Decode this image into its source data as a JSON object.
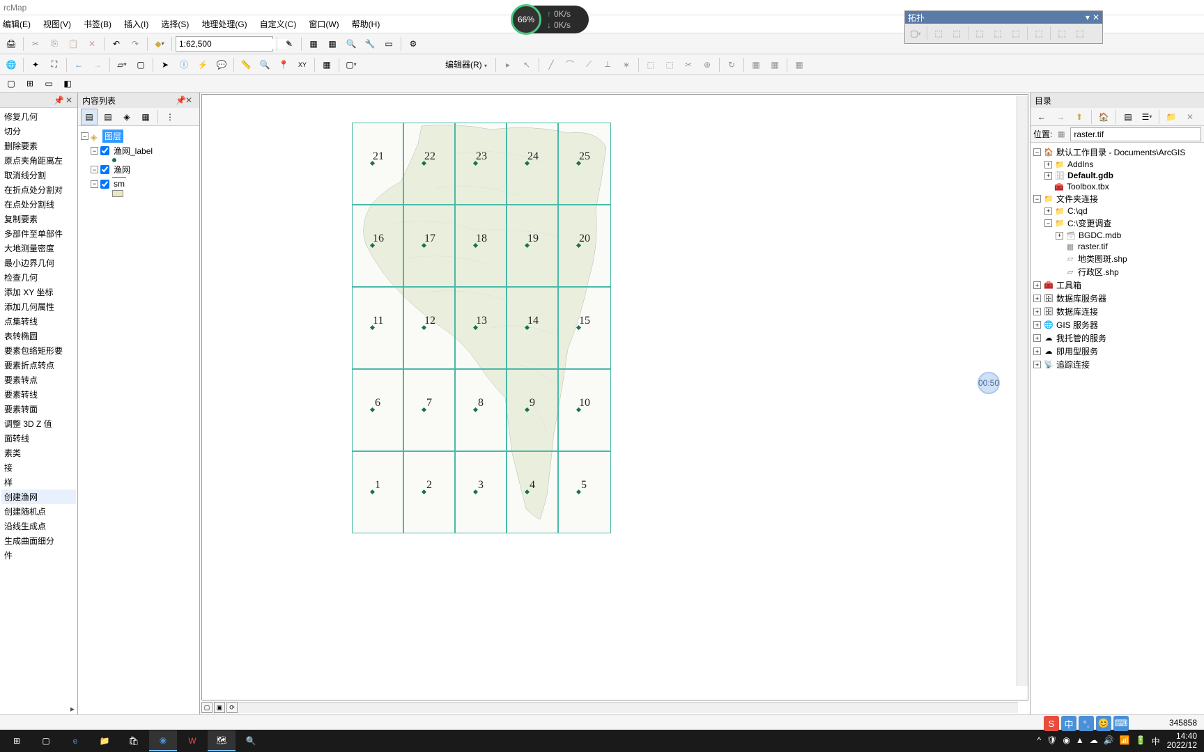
{
  "title": "rcMap",
  "menu": [
    "编辑(E)",
    "视图(V)",
    "书签(B)",
    "插入(I)",
    "选择(S)",
    "地理处理(G)",
    "自定义(C)",
    "窗口(W)",
    "帮助(H)"
  ],
  "scale": "1:62,500",
  "editor_label": "编辑器(R)",
  "topology": {
    "title": "拓扑"
  },
  "speed": {
    "pct": "66%",
    "up": "0K/s",
    "down": "0K/s"
  },
  "timer": "00:50",
  "toc": {
    "title": "内容列表",
    "root": "图层",
    "layers": [
      "渔网_label",
      "渔网",
      "sm"
    ]
  },
  "left_tools": [
    "修复几何",
    "切分",
    "删除要素",
    "原点夹角距离左",
    "取消线分割",
    "在折点处分割对",
    "在点处分割线",
    "复制要素",
    "多部件至单部件",
    "大地测量密度",
    "最小边界几何",
    "检查几何",
    "添加 XY 坐标",
    "添加几何属性",
    "点集转线",
    "表转椭圆",
    "要素包络矩形要",
    "要素折点转点",
    "要素转点",
    "要素转线",
    "要素转面",
    "调整 3D Z 值",
    "面转线",
    "素类",
    "接",
    "样",
    "创建渔网",
    "创建随机点",
    "沿线生成点",
    "生成曲面细分",
    "件"
  ],
  "left_highlight_index": 26,
  "grid_labels": {
    "row0": [
      "21",
      "22",
      "23",
      "24",
      "25"
    ],
    "row1": [
      "16",
      "17",
      "18",
      "19",
      "20"
    ],
    "row2": [
      "11",
      "12",
      "13",
      "14",
      "15"
    ],
    "row3": [
      "6",
      "7",
      "8",
      "9",
      "10"
    ],
    "row4": [
      "1",
      "2",
      "3",
      "4",
      "5"
    ]
  },
  "catalog": {
    "title": "目录",
    "location_label": "位置:",
    "location_value": "raster.tif",
    "tree": {
      "root1": "默认工作目录 - Documents\\ArcGIS",
      "addins": "AddIns",
      "defaultgdb": "Default.gdb",
      "toolboxtbx": "Toolbox.tbx",
      "folderconn": "文件夹连接",
      "cqd": "C:\\qd",
      "cbgdc": "C:\\变更调查",
      "bgdcmdb": "BGDC.mdb",
      "rastertif": "raster.tif",
      "dltb": "地类图斑.shp",
      "xzq": "行政区.shp",
      "toolbox": "工具箱",
      "dbserver": "数据库服务器",
      "dbconn": "数据库连接",
      "gisserver": "GIS 服务器",
      "myhosted": "我托管的服务",
      "ready": "即用型服务",
      "tracking": "追踪连接"
    }
  },
  "status_coord": "345858",
  "clock": {
    "time": "14:40",
    "date": "2022/12"
  }
}
